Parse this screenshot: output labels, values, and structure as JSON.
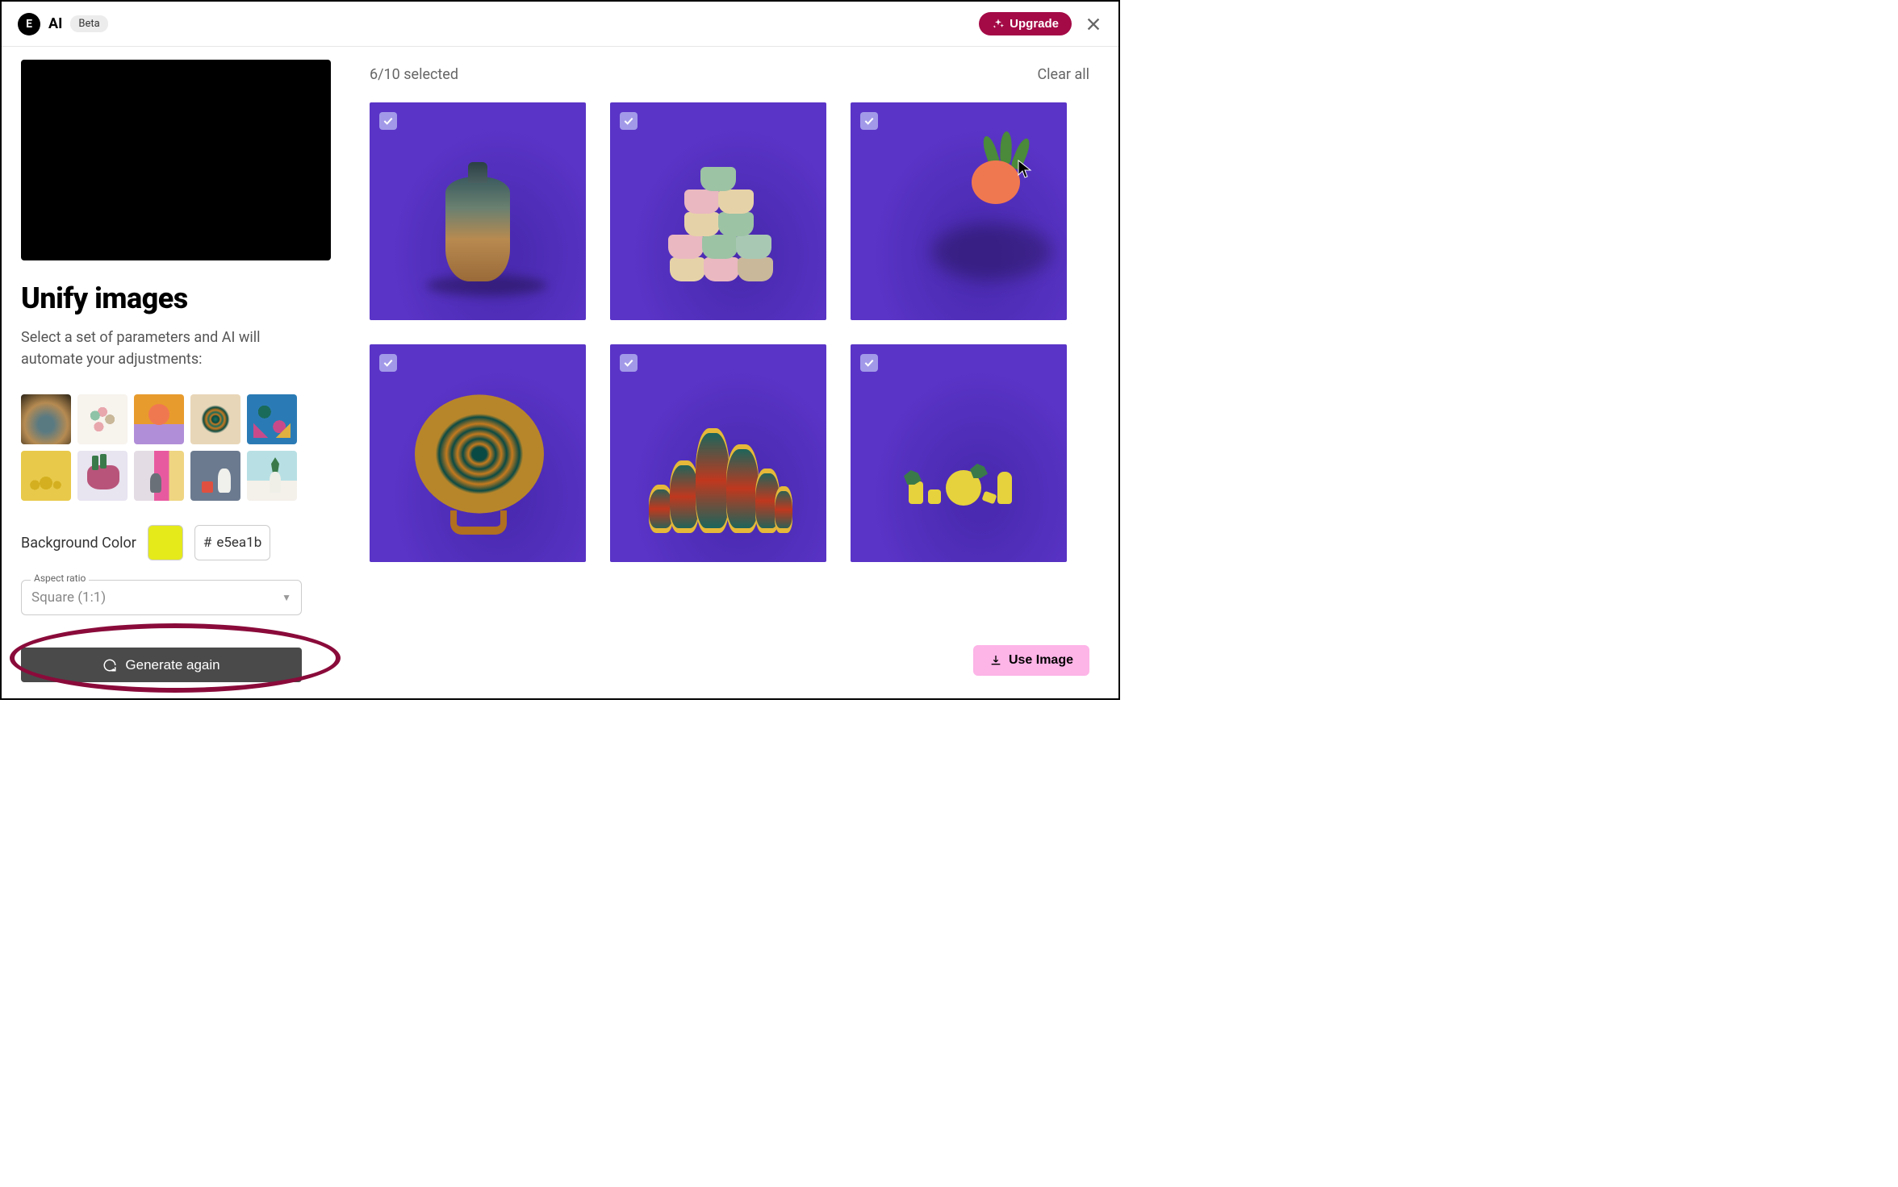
{
  "header": {
    "logo_letter": "E",
    "brand": "AI",
    "beta_label": "Beta",
    "upgrade_label": "Upgrade"
  },
  "sidebar": {
    "title": "Unify images",
    "description": "Select a set of parameters and AI will automate your adjustments:",
    "bg_color_label": "Background Color",
    "bg_color_hash": "#",
    "bg_color_value": "e5ea1b",
    "bg_color_swatch": "#e5ea1b",
    "aspect_label": "Aspect ratio",
    "aspect_value": "Square (1:1)",
    "generate_label": "Generate again"
  },
  "main": {
    "selected_text": "6/10 selected",
    "clear_all": "Clear all",
    "use_image": "Use Image"
  }
}
